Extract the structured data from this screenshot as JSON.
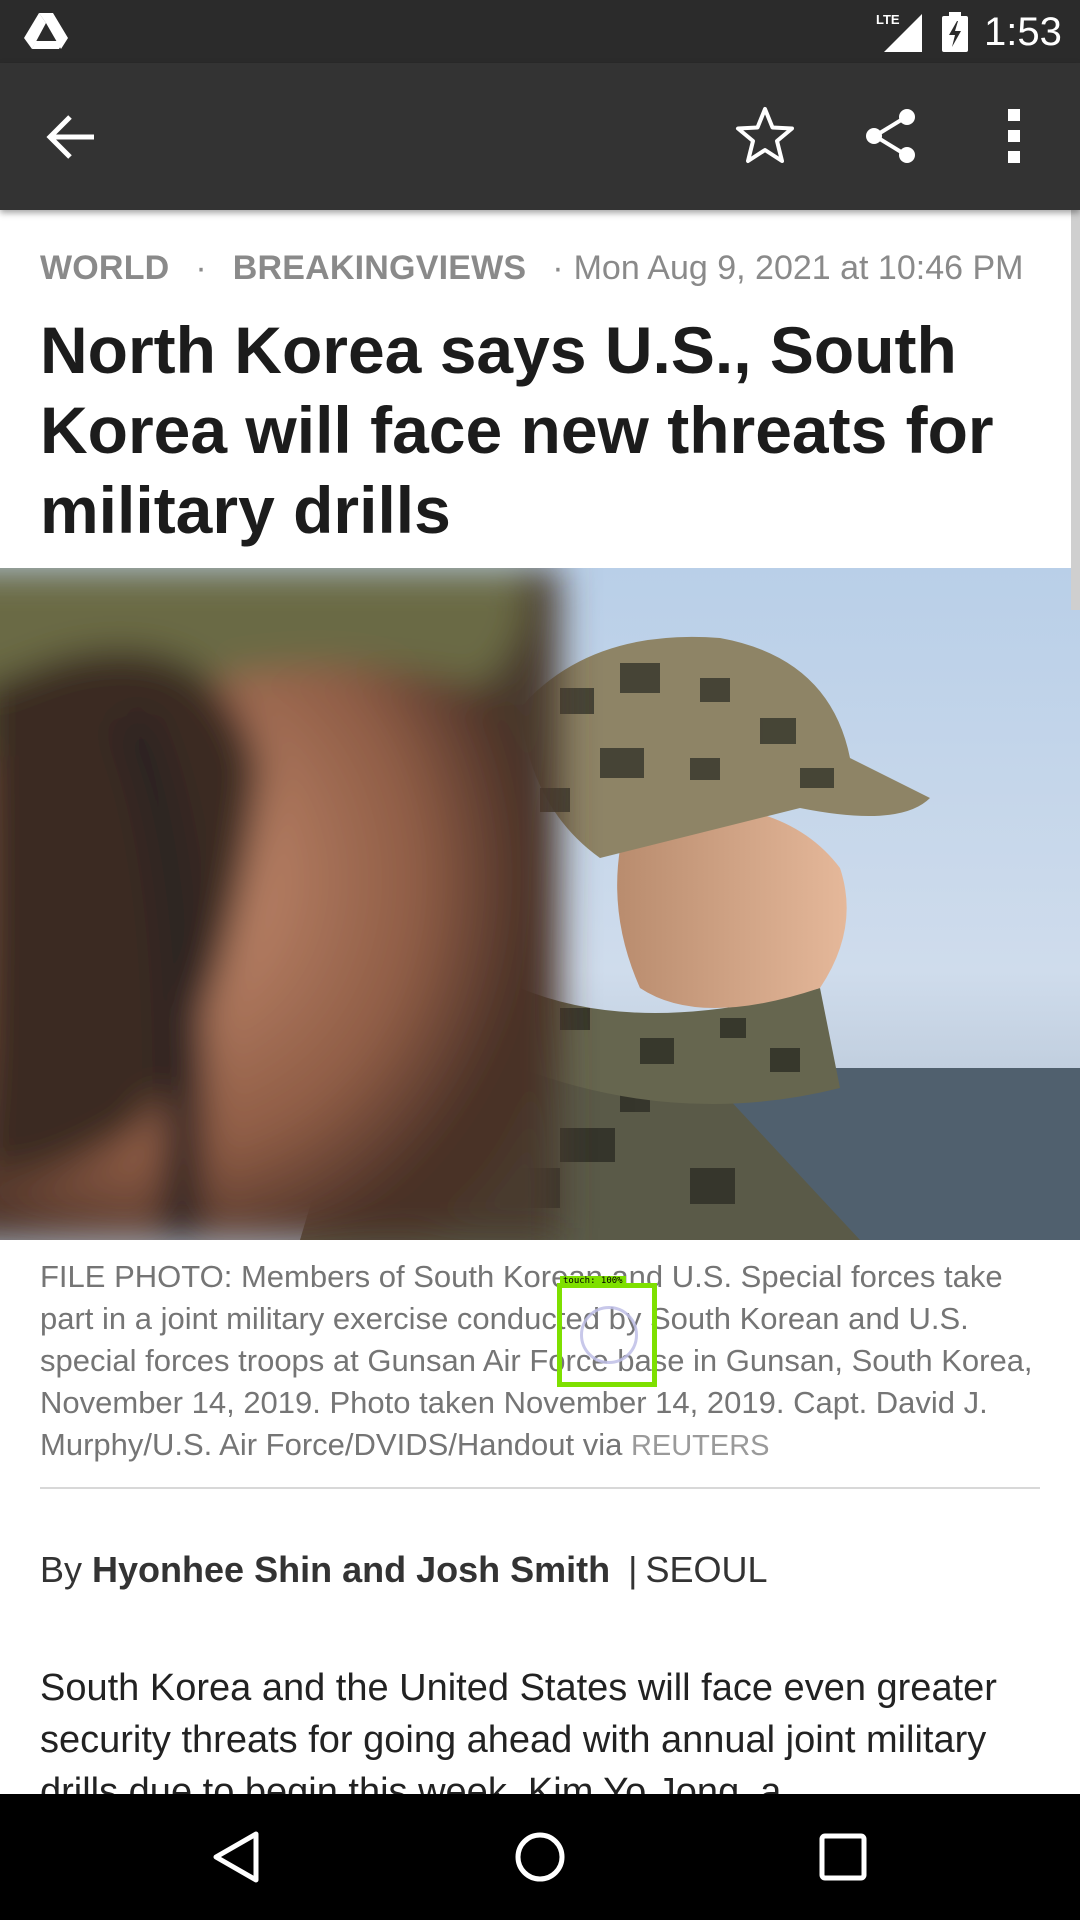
{
  "status_bar": {
    "time": "1:53",
    "network": "LTE",
    "icons": [
      "drive-icon",
      "lte-signal-icon",
      "battery-charging-icon"
    ]
  },
  "app_bar": {
    "icons": [
      "back-arrow-icon",
      "star-icon",
      "share-icon",
      "more-vert-icon"
    ]
  },
  "article": {
    "section": "WORLD",
    "separator": "·",
    "category": "BREAKINGVIEWS",
    "timestamp": "Mon Aug 9, 2021 at 10:46 PM",
    "headline": "North Korea says U.S., South Korea will face new threats for military drills",
    "photo_caption": "FILE PHOTO: Members of South Korean and U.S. Special forces take part in a joint military exercise conducted by South Korean and U.S. special forces troops at Gunsan Air Force base in Gunsan, South Korea, November 14, 2019.  Photo taken November 14, 2019.  Capt. David J. Murphy/U.S. Air Force/DVIDS/Handout via",
    "photo_credit": "REUTERS",
    "byline_prefix": "By",
    "authors": "Hyonhee Shin and Josh Smith",
    "byline_pipe": "|",
    "dateline": "SEOUL",
    "body": "South Korea and the United States will face even greater security threats for going ahead with annual joint military drills due to begin this week, Kim Yo Jong, a"
  },
  "touch_overlay": {
    "label": "touch:  100%",
    "color": "#7ee000"
  },
  "nav_bar": {
    "icons": [
      "nav-back-icon",
      "nav-home-icon",
      "nav-recents-icon"
    ]
  },
  "colors": {
    "status_bar": "#2b2b2b",
    "app_bar": "#333333",
    "headline": "#1c1c1c",
    "meta": "#8a8a8a",
    "nav_bar": "#000000"
  }
}
